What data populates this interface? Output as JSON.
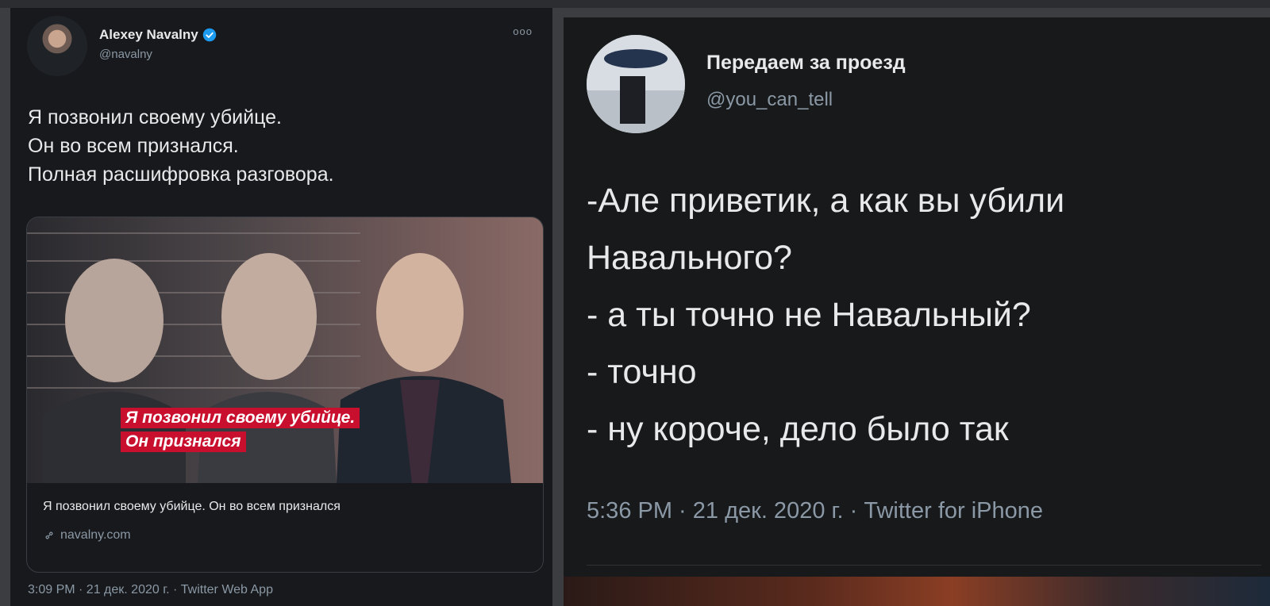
{
  "left_tweet": {
    "author_name": "Alexey Navalny",
    "handle": "@navalny",
    "more": "ooo",
    "lines": [
      "Я позвонил своему убийце.",
      "Он во всем признался.",
      "Полная расшифровка разговора."
    ],
    "card": {
      "overlay_line1": "Я позвонил своему убийце.",
      "overlay_line2": "Он признался",
      "title": "Я позвонил своему убийце. Он во всем признался",
      "domain": "navalny.com"
    },
    "footer": "3:09 PM · 21 дек. 2020 г. · Twitter Web App"
  },
  "right_tweet": {
    "author_name": "Передаем за проезд",
    "handle": "@you_can_tell",
    "lines": [
      "-Але приветик, а как вы убили",
      "Навального?",
      "- а ты точно не Навальный?",
      "- точно",
      "- ну короче, дело было так"
    ],
    "footer": "5:36 PM · 21 дек. 2020 г. · Twitter for iPhone"
  },
  "colors": {
    "background": "#17191c",
    "text": "#e7e9ea",
    "secondary_text": "#8b98a5",
    "verified": "#1d9bf0",
    "overlay_red": "#c8102e"
  }
}
